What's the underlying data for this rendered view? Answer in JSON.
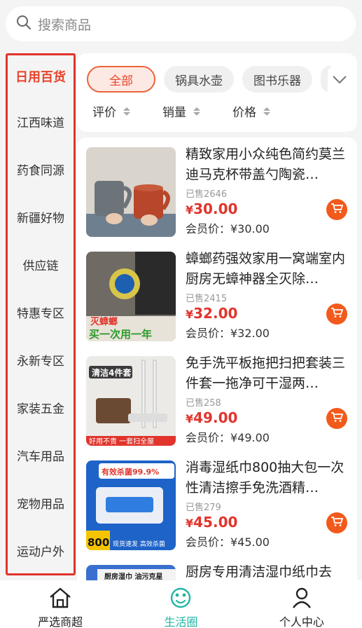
{
  "search": {
    "placeholder": "搜索商品",
    "icon": "search-icon"
  },
  "sidebar": {
    "items": [
      {
        "label": "日用百货",
        "active": true
      },
      {
        "label": "江西味道"
      },
      {
        "label": "药食同源"
      },
      {
        "label": "新疆好物"
      },
      {
        "label": "供应链"
      },
      {
        "label": "特惠专区"
      },
      {
        "label": "永新专区"
      },
      {
        "label": "家装五金"
      },
      {
        "label": "汽车用品"
      },
      {
        "label": "宠物用品"
      },
      {
        "label": "运动户外"
      }
    ]
  },
  "filter": {
    "tabs": [
      {
        "label": "全部",
        "active": true
      },
      {
        "label": "锅具水壶"
      },
      {
        "label": "图书乐器"
      }
    ],
    "sorts": [
      {
        "label": "评价"
      },
      {
        "label": "销量"
      },
      {
        "label": "价格"
      }
    ]
  },
  "products": [
    {
      "name": "精致家用小众纯色简约莫兰迪马克杯带盖勺陶瓷…",
      "sold": "已售2646",
      "currency": "¥",
      "price": "30.00",
      "member_price": "会员价：¥30.00"
    },
    {
      "name": "蟑螂药强效家用一窝端室内厨房无蟑神器全灭除…",
      "sold": "已售2415",
      "currency": "¥",
      "price": "32.00",
      "member_price": "会员价：¥32.00",
      "image_text": [
        "灭蟑螂",
        "买一次用一年"
      ]
    },
    {
      "name": "免手洗平板拖把扫把套装三件套一拖净可干湿两…",
      "sold": "已售258",
      "currency": "¥",
      "price": "49.00",
      "member_price": "会员价：¥49.00",
      "image_text": [
        "清洁4件套",
        "好用不贵 一套扫全屋"
      ]
    },
    {
      "name": "消毒湿纸巾800抽大包一次性清洁擦手免洗酒精…",
      "sold": "已售279",
      "currency": "¥",
      "price": "45.00",
      "member_price": "会员价：¥45.00",
      "image_text": [
        "有效杀菌99.9%",
        "800",
        "现货速发 高效杀菌"
      ]
    },
    {
      "name": "厨房专用清洁湿巾纸巾去",
      "image_text": [
        "厨房湿巾 油污克星"
      ]
    }
  ],
  "tabbar": {
    "items": [
      {
        "label": "严选商超",
        "icon": "home-icon"
      },
      {
        "label": "生活圈",
        "icon": "life-circle-icon",
        "active": true
      },
      {
        "label": "个人中心",
        "icon": "user-icon"
      }
    ]
  },
  "colors": {
    "accent": "#e8432b",
    "cart": "#f25a1c",
    "active_tab": "#1fb5a2",
    "sidebar_border": "#e0342c"
  }
}
